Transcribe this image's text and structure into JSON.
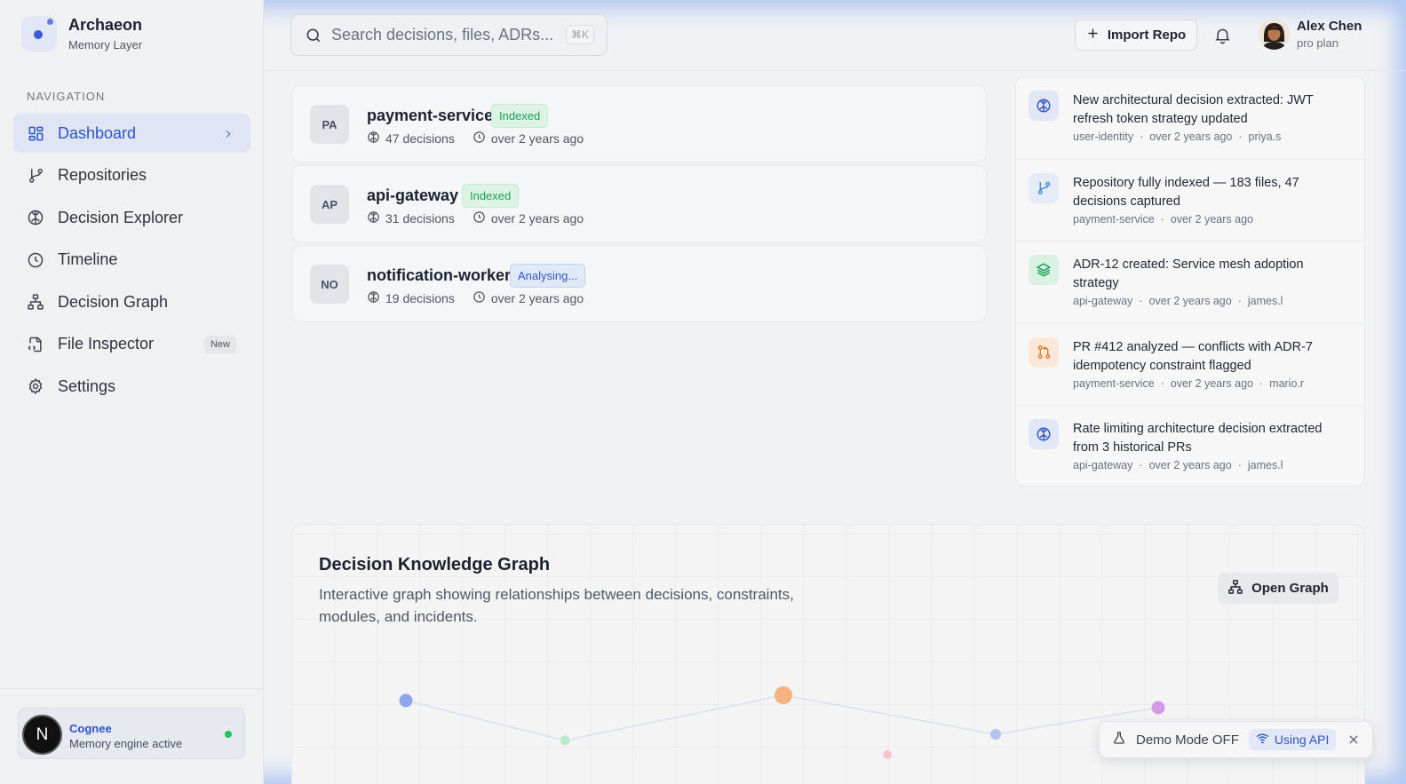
{
  "brand": {
    "name": "Archaeon",
    "subtitle": "Memory Layer"
  },
  "navigation": {
    "heading": "NAVIGATION",
    "items": [
      {
        "label": "Dashboard",
        "icon": "dashboard-icon",
        "active": true
      },
      {
        "label": "Repositories",
        "icon": "git-branch-icon"
      },
      {
        "label": "Decision Explorer",
        "icon": "brain-icon"
      },
      {
        "label": "Timeline",
        "icon": "clock-icon"
      },
      {
        "label": "Decision Graph",
        "icon": "network-icon"
      },
      {
        "label": "File Inspector",
        "icon": "file-code-icon",
        "badge": "New"
      },
      {
        "label": "Settings",
        "icon": "gear-icon"
      }
    ]
  },
  "engine": {
    "avatar_letter": "N",
    "name": "Cognee",
    "status": "Memory engine active",
    "status_color": "#22c55e"
  },
  "search": {
    "placeholder": "Search decisions, files, ADRs...",
    "shortcut": "⌘K"
  },
  "header": {
    "import_label": "Import Repo"
  },
  "user": {
    "name": "Alex Chen",
    "plan": "pro plan"
  },
  "repos": [
    {
      "abbr": "PA",
      "name": "payment-service",
      "status": "Indexed",
      "decisions": "47 decisions",
      "updated": "over 2 years ago"
    },
    {
      "abbr": "AP",
      "name": "api-gateway",
      "status": "Indexed",
      "decisions": "31 decisions",
      "updated": "over 2 years ago"
    },
    {
      "abbr": "NO",
      "name": "notification-worker",
      "status": "Analysing...",
      "decisions": "19 decisions",
      "updated": "over 2 years ago"
    }
  ],
  "activity": [
    {
      "icon": "brain-icon",
      "title": "New architectural decision extracted: JWT refresh token strategy updated",
      "repo": "user-identity",
      "time": "over 2 years ago",
      "author": "priya.s"
    },
    {
      "icon": "git-branch-icon",
      "title": "Repository fully indexed — 183 files, 47 decisions captured",
      "repo": "payment-service",
      "time": "over 2 years ago",
      "author": ""
    },
    {
      "icon": "layers-icon",
      "title": "ADR-12 created: Service mesh adoption strategy",
      "repo": "api-gateway",
      "time": "over 2 years ago",
      "author": "james.l"
    },
    {
      "icon": "git-pull-request-icon",
      "title": "PR #412 analyzed — conflicts with ADR-7 idempotency constraint flagged",
      "repo": "payment-service",
      "time": "over 2 years ago",
      "author": "mario.r"
    },
    {
      "icon": "brain-icon",
      "title": "Rate limiting architecture decision extracted from 3 historical PRs",
      "repo": "api-gateway",
      "time": "over 2 years ago",
      "author": "james.l"
    }
  ],
  "graph": {
    "title": "Decision Knowledge Graph",
    "description": "Interactive graph showing relationships between decisions, constraints, modules, and incidents.",
    "open_label": "Open Graph",
    "node_colors": [
      "#8ea6ee",
      "#b9e8cb",
      "#f5b282",
      "#f7c4cc",
      "#b3c3ee",
      "#d49be9"
    ]
  },
  "demo": {
    "label": "Demo Mode OFF",
    "api_label": "Using API"
  },
  "colors": {
    "accent": "#2f54c9",
    "indexed": "#18a055",
    "sidebar_active_bg": "#dfe5f5"
  }
}
